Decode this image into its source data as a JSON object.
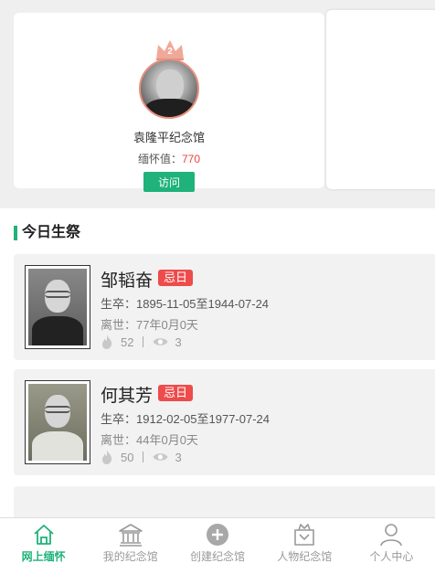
{
  "featured": {
    "rank": "2",
    "name": "袁隆平纪念馆",
    "value_label": "缅怀值：",
    "value": "770",
    "visit_label": "访问"
  },
  "section": {
    "title": "今日生祭"
  },
  "people": [
    {
      "name": "邹韬奋",
      "tag": "忌日",
      "dates": "生卒：1895-11-05至1944-07-24",
      "passed": "离世：77年0月0天",
      "flowers": "52",
      "views": "3"
    },
    {
      "name": "何其芳",
      "tag": "忌日",
      "dates": "生卒：1912-02-05至1977-07-24",
      "passed": "离世：44年0月0天",
      "flowers": "50",
      "views": "3"
    }
  ],
  "tabs": [
    {
      "label": "网上缅怀",
      "icon": "home-icon",
      "active": true
    },
    {
      "label": "我的纪念馆",
      "icon": "memorial-hall-icon",
      "active": false
    },
    {
      "label": "创建纪念馆",
      "icon": "plus-circle-icon",
      "active": false
    },
    {
      "label": "人物纪念馆",
      "icon": "person-memorial-icon",
      "active": false
    },
    {
      "label": "个人中心",
      "icon": "user-icon",
      "active": false
    }
  ],
  "colors": {
    "accent": "#1fb27a",
    "tag": "#ee4b4b",
    "value": "#e8453c",
    "crown": "#e8907f"
  }
}
